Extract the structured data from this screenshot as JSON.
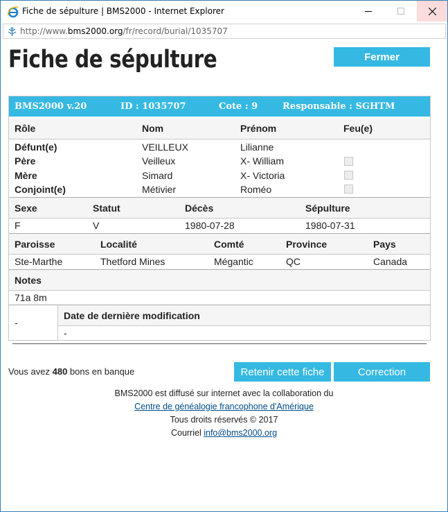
{
  "window": {
    "title": "Fiche de sépulture | BMS2000 - Internet Explorer",
    "url_prefix": "http://www.",
    "url_domain": "bms2000.org",
    "url_path": "/fr/record/burial/1035707"
  },
  "page": {
    "title": "Fiche de sépulture",
    "close_label": "Fermer"
  },
  "record": {
    "header": {
      "version": "BMS2000 v.20",
      "id": "ID : 1035707",
      "cote": "Cote : 9",
      "responsable": "Responsable : SGHTM"
    },
    "persons": {
      "headers": [
        "Rôle",
        "Nom",
        "Prénom",
        "Feu(e)"
      ],
      "rows": [
        {
          "role": "Défunt(e)",
          "nom": "VEILLEUX",
          "prenom": "Lilianne",
          "feu": null
        },
        {
          "role": "Père",
          "nom": "Veilleux",
          "prenom": "X- William",
          "feu": false
        },
        {
          "role": "Mère",
          "nom": "Simard",
          "prenom": "X- Victoria",
          "feu": false
        },
        {
          "role": "Conjoint(e)",
          "nom": "Métivier",
          "prenom": "Roméo",
          "feu": false
        }
      ]
    },
    "details": {
      "headers": [
        "Sexe",
        "Statut",
        "Décès",
        "Sépulture"
      ],
      "values": [
        "F",
        "V",
        "1980-07-28",
        "1980-07-31"
      ]
    },
    "location": {
      "headers": [
        "Paroisse",
        "Localité",
        "Comté",
        "Province",
        "Pays"
      ],
      "values": [
        "Ste-Marthe",
        "Thetford Mines",
        "Mégantic",
        "QC",
        "Canada"
      ]
    },
    "notes": {
      "header": "Notes",
      "value": "71a 8m"
    },
    "modification": {
      "left_value": "-",
      "header": "Date de dernière modification",
      "value": "-"
    }
  },
  "bons": {
    "prefix": "Vous avez ",
    "count": "480",
    "suffix": " bons en banque"
  },
  "actions": {
    "keep_label": "Retenir cette fiche",
    "correct_label": "Correction"
  },
  "footer": {
    "line1": "BMS2000 est diffusé sur internet avec la collaboration du",
    "link1": "Centre de généalogie francophone d'Amérique",
    "line3": "Tous droits réservés © 2017",
    "email_prefix": "Courriel ",
    "email": "info@bms2000.org"
  },
  "colors": {
    "accent": "#35b9e2",
    "close_hover": "#fadcdc",
    "link": "#004b88"
  }
}
